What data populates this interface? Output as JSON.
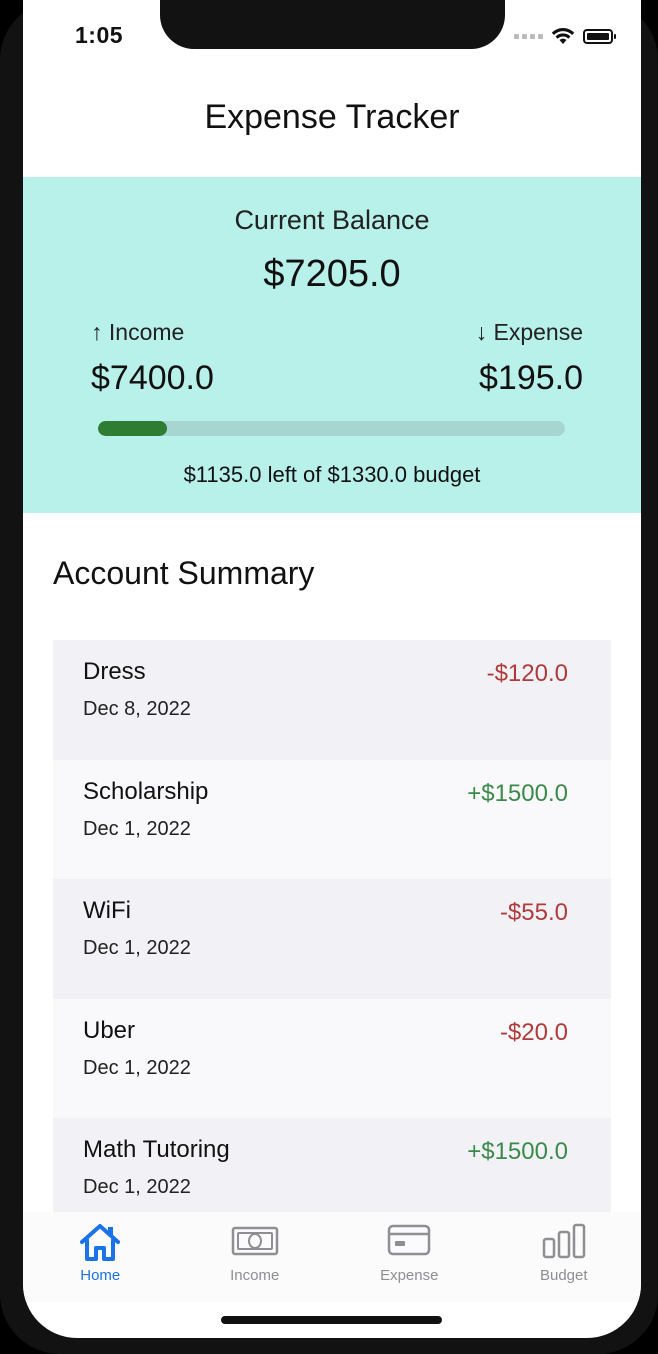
{
  "status_bar": {
    "time": "1:05"
  },
  "header": {
    "title": "Expense Tracker"
  },
  "balance_card": {
    "label": "Current Balance",
    "value": "$7205.0",
    "income_label": "↑ Income",
    "income_value": "$7400.0",
    "expense_label": "↓ Expense",
    "expense_value": "$195.0",
    "budget_used_fraction": 0.147,
    "budget_text": "$1135.0 left of $1330.0 budget",
    "accent_color": "#b8f0ea",
    "progress_color": "#2e7d32"
  },
  "summary": {
    "title": "Account Summary",
    "items": [
      {
        "name": "Dress",
        "date": "Dec 8, 2022",
        "amount": "-$120.0",
        "kind": "expense"
      },
      {
        "name": "Scholarship",
        "date": "Dec 1, 2022",
        "amount": "+$1500.0",
        "kind": "income"
      },
      {
        "name": "WiFi",
        "date": "Dec 1, 2022",
        "amount": "-$55.0",
        "kind": "expense"
      },
      {
        "name": "Uber",
        "date": "Dec 1, 2022",
        "amount": "-$20.0",
        "kind": "expense"
      },
      {
        "name": "Math Tutoring",
        "date": "Dec 1, 2022",
        "amount": "+$1500.0",
        "kind": "income"
      }
    ]
  },
  "tab_bar": {
    "tabs": [
      {
        "label": "Home",
        "icon": "home-icon",
        "active": true
      },
      {
        "label": "Income",
        "icon": "banknote-icon",
        "active": false
      },
      {
        "label": "Expense",
        "icon": "credit-card-icon",
        "active": false
      },
      {
        "label": "Budget",
        "icon": "bar-chart-icon",
        "active": false
      }
    ]
  },
  "colors": {
    "expense_amount": "#b33a3a",
    "income_amount": "#3a8a4a",
    "tab_active": "#1a73e8",
    "tab_inactive": "#8e8e93"
  }
}
